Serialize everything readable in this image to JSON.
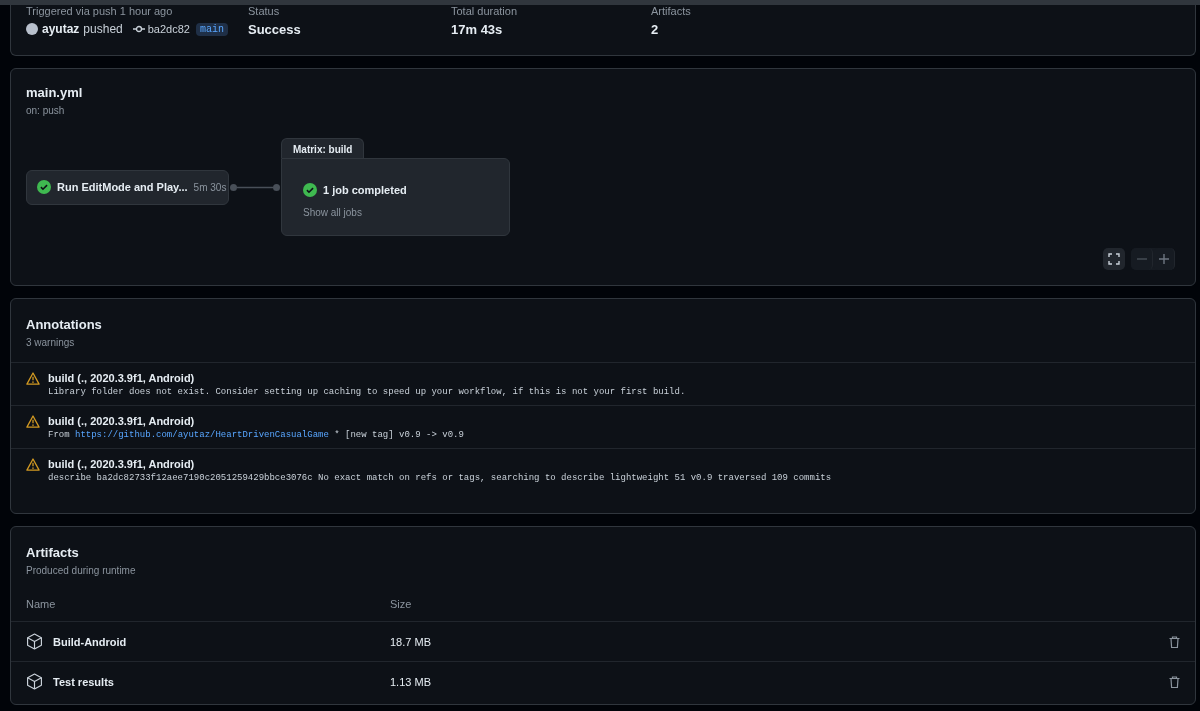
{
  "summary": {
    "trigger_label": "Triggered via push 1 hour ago",
    "actor": "ayutaz",
    "action": "pushed",
    "commit": "ba2dc82",
    "branch": "main",
    "stats": [
      {
        "label": "Status",
        "value": "Success"
      },
      {
        "label": "Total duration",
        "value": "17m 43s"
      },
      {
        "label": "Artifacts",
        "value": "2"
      }
    ]
  },
  "workflow": {
    "title": "main.yml",
    "trigger": "on: push",
    "job": {
      "name": "Run EditMode and Play...",
      "duration": "5m 30s",
      "succeeded": true
    },
    "matrix": {
      "label": "Matrix: build",
      "summary": "1 job completed",
      "succeeded": true,
      "link": "Show all jobs"
    }
  },
  "annotations": {
    "title": "Annotations",
    "subtitle": "3 warnings",
    "items": [
      {
        "title": "build (., 2020.3.9f1, Android)",
        "message": [
          {
            "kind": "text",
            "text": "Library folder does not exist. Consider setting up caching to speed up your workflow, if this is not your first build."
          }
        ]
      },
      {
        "title": "build (., 2020.3.9f1, Android)",
        "message": [
          {
            "kind": "text",
            "text": "From "
          },
          {
            "kind": "link",
            "text": "https://github.com/ayutaz/HeartDrivenCasualGame"
          },
          {
            "kind": "text",
            "text": " * [new tag] v0.9 -> v0.9"
          }
        ]
      },
      {
        "title": "build (., 2020.3.9f1, Android)",
        "message": [
          {
            "kind": "text",
            "text": "describe ba2dc82733f12aee7190c2051259429bbce3076c No exact match on refs or tags, searching to describe lightweight 51 v0.9 traversed 109 commits"
          }
        ]
      }
    ]
  },
  "artifacts": {
    "title": "Artifacts",
    "subtitle": "Produced during runtime",
    "columns": [
      "Name",
      "Size"
    ],
    "rows": [
      {
        "name": "Build-Android",
        "size": "18.7 MB"
      },
      {
        "name": "Test results",
        "size": "1.13 MB"
      }
    ]
  }
}
